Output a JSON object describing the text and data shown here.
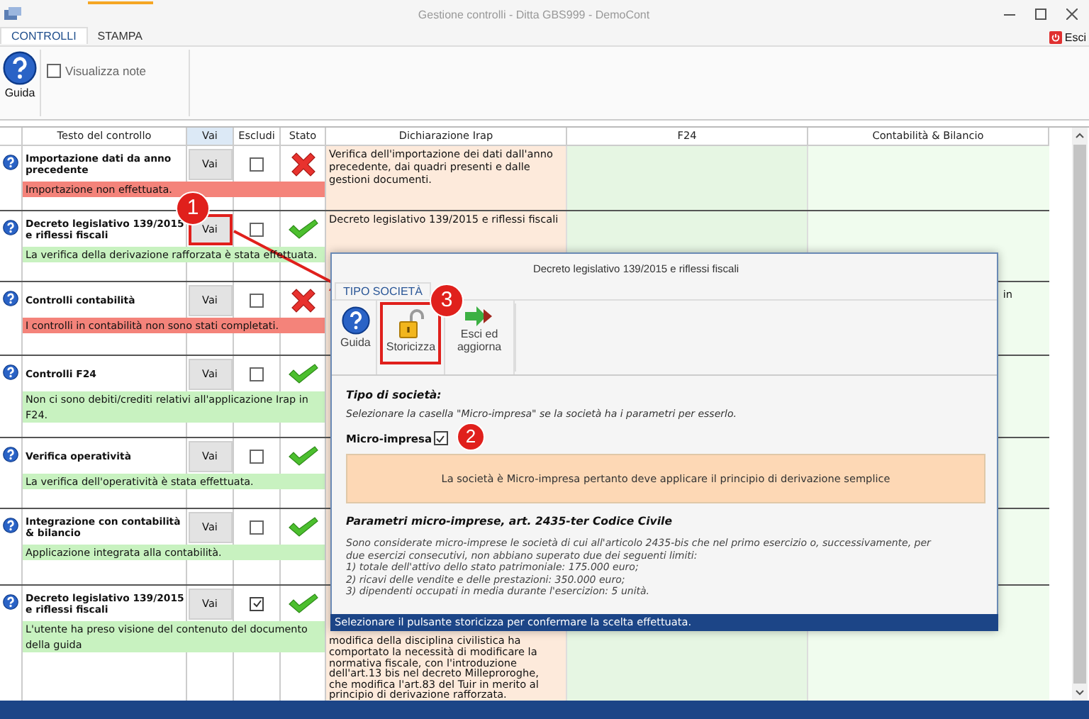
{
  "window": {
    "title": "Gestione controlli - Ditta GBS999 - DemoCont"
  },
  "tabs": [
    {
      "label": "CONTROLLI",
      "selected": true
    },
    {
      "label": "STAMPA",
      "selected": false
    }
  ],
  "exit": {
    "label": "Esci"
  },
  "ribbon": {
    "buttons": [
      {
        "label": "Guida",
        "kind": "help"
      }
    ],
    "checkbox": {
      "label": "Visualizza note",
      "checked": false
    }
  },
  "table": {
    "columns": [
      "Testo del controllo",
      "Vai",
      "Escludi",
      "Stato",
      "Dichiarazione Irap",
      "F24",
      "Contabilità & Bilancio"
    ],
    "rows": [
      {
        "title": "Importazione dati da anno precedente",
        "action": "Vai",
        "excluded": false,
        "passed": false,
        "message": "Importazione non effettuata.",
        "irap": "Verifica dell'importazione dei dati dall'anno precedente, dai quadri presenti e dalle gestioni documenti."
      },
      {
        "title": "Decreto legislativo 139/2015 e riflessi fiscali",
        "action": "Vai",
        "excluded": false,
        "passed": true,
        "message": "La verifica della derivazione rafforzata è stata effettuata.",
        "irap": "Decreto legislativo 139/2015 e riflessi fiscali",
        "callout": "1"
      },
      {
        "title": "Controlli contabilità",
        "action": "Vai",
        "excluded": false,
        "passed": false,
        "message": "I controlli in contabilità non sono stati completati.",
        "accounting": "in"
      },
      {
        "title": "Controlli F24",
        "action": "Vai",
        "excluded": false,
        "passed": true,
        "message": "Non ci sono debiti/crediti relativi all'applicazione Irap in F24."
      },
      {
        "title": "Verifica operatività",
        "action": "Vai",
        "excluded": false,
        "passed": true,
        "message": "La verifica dell'operatività è stata effettuata."
      },
      {
        "title": "Integrazione con contabilità & bilancio",
        "action": "Vai",
        "excluded": false,
        "passed": true,
        "message": "Applicazione integrata alla contabilità."
      },
      {
        "title": "Decreto legislativo 139/2015 e riflessi fiscali",
        "action": "Vai",
        "excluded": true,
        "passed": true,
        "message": "L'utente ha preso visione del contenuto del documento della guida",
        "irap": "modifica della disciplina civilistica ha\ncomportato la necessità di modificare la\nnormativa fiscale, con l'introduzione\ndell'art.13 bis nel decreto Milleproroghe,\nche modifica l'art.83 del Tuir in merito al\nprincipio di derivazione rafforzata."
      }
    ]
  },
  "dialog": {
    "title": "Decreto legislativo 139/2015 e riflessi fiscali",
    "tabs": [
      {
        "label": "TIPO SOCIETÀ",
        "selected": true
      }
    ],
    "buttons": [
      {
        "label": "Guida",
        "kind": "help"
      },
      {
        "label": "Storicizza",
        "kind": "lock",
        "callout": "3"
      },
      {
        "label": "Esci ed aggiorna",
        "kind": "exit"
      }
    ],
    "section_title": "Tipo di società:",
    "instruction": "Selezionare la casella \"Micro-impresa\" se la società ha i parametri per esserlo.",
    "checkbox": {
      "label": "Micro-impresa",
      "checked": true,
      "callout": "2"
    },
    "notice": "La società è Micro-impresa pertanto deve applicare il principio di derivazione semplice",
    "params_title": "Parametri micro-imprese, art. 2435-ter Codice Civile",
    "params_text": "Sono considerate micro-imprese le società di cui all'articolo 2435-bis che nel primo esercizio o, successivamente, per\ndue esercizi consecutivi, non abbiano superato due dei seguenti limiti:\n1) totale dell'attivo dello stato patrimoniale: 175.000 euro;\n2) ricavi delle vendite e delle prestazioni: 350.000 euro;\n3) dipendenti occupati in media durante l'esercizion: 5 unità.",
    "status": "Selezionare il pulsante storicizza per confermare la scelta effettuata."
  }
}
